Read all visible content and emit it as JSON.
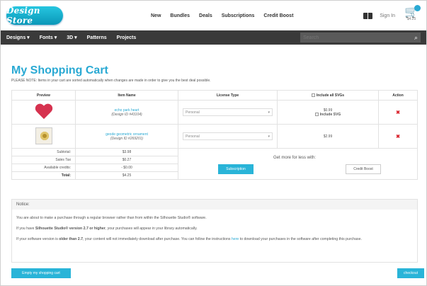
{
  "logo": {
    "text": "Design Store"
  },
  "topnav": [
    "New",
    "Bundles",
    "Deals",
    "Subscriptions",
    "Credit Boost"
  ],
  "header": {
    "signin": "Sign In",
    "cart_amount": "$4.25"
  },
  "mainnav": [
    "Designs ▾",
    "Fonts ▾",
    "3D ▾",
    "Patterns",
    "Projects"
  ],
  "search": {
    "placeholder": "Search"
  },
  "page": {
    "title": "My Shopping Cart",
    "note": "PLEASE NOTE: Items in your cart are sorted automatically when changes are made in order to give you the best deal possible."
  },
  "table": {
    "headers": {
      "preview": "Preview",
      "item_name": "Item Name",
      "license": "License Type",
      "include_all": "Include all SVGs",
      "action": "Action"
    },
    "items": [
      {
        "name": "echo park heart",
        "id": "(Design ID #43104)",
        "license": "Personal",
        "price": "$0.99",
        "include_svg": "Include SVG",
        "preview_icon": "heart-icon"
      },
      {
        "name": "geode geometric ornament",
        "id": "(Design ID #269201)",
        "license": "Personal",
        "price": "$2.99",
        "preview_icon": "ornament-icon"
      }
    ],
    "summary": [
      {
        "label": "Subtotal:",
        "value": "$3.98"
      },
      {
        "label": "Sales Tax",
        "value": "$0.27"
      },
      {
        "label": "Available credits:",
        "value": "- $0.00"
      },
      {
        "label": "Total:",
        "value": "$4.25"
      }
    ],
    "promo": {
      "text": "Get more for less with:",
      "subscription": "Subscription",
      "credit_boost": "Credit Boost"
    }
  },
  "notice": {
    "heading": "Notice:",
    "p1": "You are about to make a purchase through a regular browser rather than from within the Silhouette Studio® software.",
    "p2_a": "If you have ",
    "p2_bold": "Silhouette Studio® version 2.7 or higher",
    "p2_b": ", your purchases will appear in your library automatically.",
    "p3_a": "If your software version is ",
    "p3_bold": "older than 2.7",
    "p3_b": ", your content will not immediately download after purchase. You can follow the instructions ",
    "p3_link": "here",
    "p3_c": " to download your purchases in the software after completing this purchase."
  },
  "buttons": {
    "empty": "Empty my shopping cart",
    "checkout": "checkout"
  },
  "colors": {
    "accent": "#29a9d3",
    "nav_bg": "#3a3a3a",
    "remove": "#d9212b",
    "heart": "#d6324f"
  }
}
